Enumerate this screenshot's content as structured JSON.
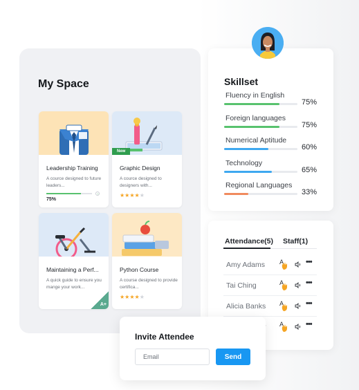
{
  "my_space": {
    "title": "My Space",
    "courses": [
      {
        "title": "Leadership Training",
        "description": "A cource designed to future leaders...",
        "progress_label": "75%",
        "progress": 0.75,
        "icon": "business-suit-icon",
        "thumb_color": "#fde3b6"
      },
      {
        "title": "Graphic Design",
        "description": "A cource designed to designers with...",
        "badge": "New",
        "rating": 4,
        "icon": "design-tools-icon",
        "thumb_color": "#dde9f7"
      },
      {
        "title": "Maintaining a Perf...",
        "description": "A quick guide to ensure you mange your work...",
        "badge": "A+",
        "icon": "exercise-bike-icon",
        "thumb_color": "#dde9f7"
      },
      {
        "title": "Python Course",
        "description": "A course designed to provide certifica...",
        "rating": 4,
        "icon": "books-apple-icon",
        "thumb_color": "#fde8c4"
      }
    ]
  },
  "skillset": {
    "title": "Skillset",
    "skills": [
      {
        "name": "Fluency in English",
        "percent_label": "75%",
        "value": 75,
        "color": "#58c26e"
      },
      {
        "name": "Foreign languages",
        "percent_label": "75%",
        "value": 75,
        "color": "#58c26e"
      },
      {
        "name": "Numerical Aptitude",
        "percent_label": "60%",
        "value": 60,
        "color": "#3ea8f0"
      },
      {
        "name": "Technology",
        "percent_label": "65%",
        "value": 65,
        "color": "#3ea8f0"
      },
      {
        "name": "Regional Languages",
        "percent_label": "33%",
        "value": 33,
        "color": "#f08a5d"
      }
    ]
  },
  "attendance": {
    "tabs": [
      "Attendance(5)",
      "Staff(1)"
    ],
    "active_tab": 0,
    "attendees": [
      {
        "name": "Amy Adams"
      },
      {
        "name": "Tai Ching"
      },
      {
        "name": "Alicia Banks"
      },
      {
        "name": "r"
      }
    ],
    "icons": [
      "raise-hand-icon",
      "speaker-icon",
      "more-icon"
    ]
  },
  "invite": {
    "title": "Invite Attendee",
    "email_placeholder": "Email",
    "send_label": "Send"
  },
  "star_glyph": "★",
  "more_glyph": "•••"
}
